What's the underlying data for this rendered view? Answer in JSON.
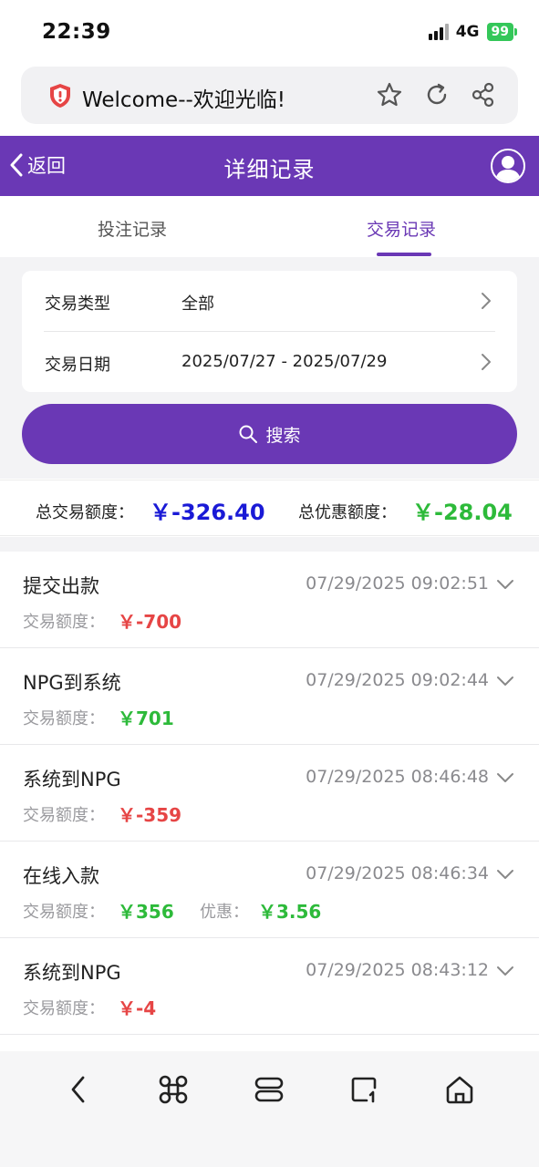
{
  "status_bar": {
    "time": "22:39",
    "network": "4G",
    "battery": "99"
  },
  "address_bar": {
    "page_title": "Welcome--欢迎光临!"
  },
  "header": {
    "back_label": "返回",
    "title": "详细记录"
  },
  "tabs": [
    {
      "label": "投注记录",
      "active": false
    },
    {
      "label": "交易记录",
      "active": true
    }
  ],
  "filters": {
    "type_label": "交易类型",
    "type_value": "全部",
    "date_label": "交易日期",
    "date_value": "2025/07/27 - 2025/07/29"
  },
  "search_button": "搜索",
  "summary": {
    "total_label": "总交易额度：",
    "total_value": "￥-326.40",
    "bonus_label": "总优惠额度：",
    "bonus_value": "￥-28.04"
  },
  "records": [
    {
      "title": "提交出款",
      "time": "07/29/2025 09:02:51",
      "amount_label": "交易额度：",
      "amount": "￥-700",
      "sign": "neg"
    },
    {
      "title": "NPG到系统",
      "time": "07/29/2025 09:02:44",
      "amount_label": "交易额度：",
      "amount": "￥701",
      "sign": "pos"
    },
    {
      "title": "系统到NPG",
      "time": "07/29/2025 08:46:48",
      "amount_label": "交易额度：",
      "amount": "￥-359",
      "sign": "neg"
    },
    {
      "title": "在线入款",
      "time": "07/29/2025 08:46:34",
      "amount_label": "交易额度：",
      "amount": "￥356",
      "sign": "pos",
      "bonus_label": "优惠：",
      "bonus": "￥3.56"
    },
    {
      "title": "系统到NPG",
      "time": "07/29/2025 08:43:12",
      "amount_label": "交易额度：",
      "amount": "￥-4",
      "sign": "neg"
    }
  ],
  "colors": {
    "brand": "#6a38b5",
    "negative": "#e64545",
    "positive": "#2dba3a",
    "total": "#1a1ad6"
  },
  "icons": [
    "shield-icon",
    "star-icon",
    "reload-icon",
    "share-icon",
    "back-chevron-icon",
    "user-avatar-icon",
    "chevron-right-icon",
    "search-icon",
    "chevron-down-icon",
    "browser-back-icon",
    "command-icon",
    "tabs-icon",
    "tab-switch-icon",
    "home-icon"
  ]
}
